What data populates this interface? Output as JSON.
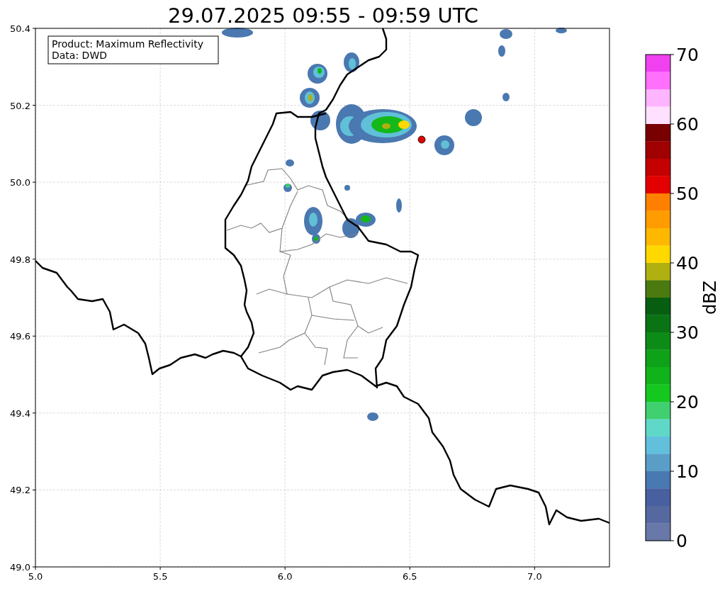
{
  "title": "29.07.2025 09:55 - 09:59 UTC",
  "info_box": {
    "lines": [
      "Product: Maximum Reflectivity",
      "Data: DWD"
    ]
  },
  "map": {
    "xticks": [
      "5.0",
      "5.5",
      "6.0",
      "6.5",
      "7.0"
    ],
    "yticks": [
      "50.4",
      "50.2",
      "50.0",
      "49.8",
      "49.6",
      "49.4",
      "49.2",
      "49.0"
    ]
  },
  "colorbar": {
    "label": "dBZ",
    "ticks": [
      "70",
      "60",
      "50",
      "40",
      "30",
      "20",
      "10",
      "0"
    ],
    "bands": [
      {
        "color": "#f040f0"
      },
      {
        "color": "#ff70ff"
      },
      {
        "color": "#ffb4ff"
      },
      {
        "color": "#ffe0ff"
      },
      {
        "color": "#780000"
      },
      {
        "color": "#a00000"
      },
      {
        "color": "#c40000"
      },
      {
        "color": "#e40000"
      },
      {
        "color": "#ff8000"
      },
      {
        "color": "#ff9c00"
      },
      {
        "color": "#ffb800"
      },
      {
        "color": "#ffd800"
      },
      {
        "color": "#b0b010"
      },
      {
        "color": "#4a7a10"
      },
      {
        "color": "#085e10"
      },
      {
        "color": "#0a7414"
      },
      {
        "color": "#0c8c16"
      },
      {
        "color": "#0ea218"
      },
      {
        "color": "#10b41a"
      },
      {
        "color": "#14c820"
      },
      {
        "color": "#40d070"
      },
      {
        "color": "#60d8c8"
      },
      {
        "color": "#62c0dc"
      },
      {
        "color": "#5a9ec8"
      },
      {
        "color": "#4a78b0"
      },
      {
        "color": "#4860a0"
      },
      {
        "color": "#5668a0"
      },
      {
        "color": "#6878a8"
      }
    ]
  }
}
